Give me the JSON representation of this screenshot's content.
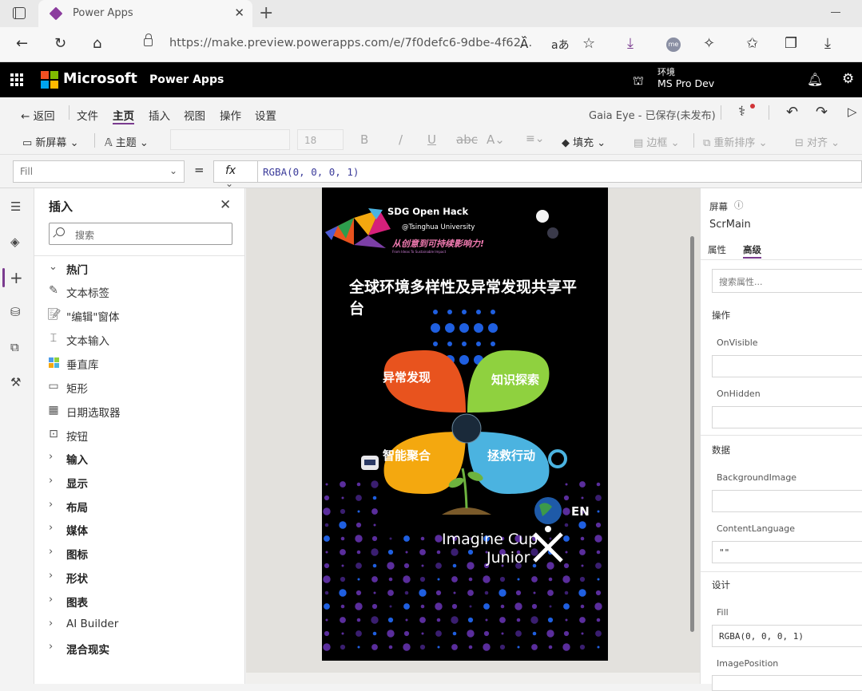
{
  "browser": {
    "tab_title": "Power Apps",
    "url": "https://make.preview.powerapps.com/e/7f0defc6-9dbe-4f62...",
    "profile_initials": "me"
  },
  "appbar": {
    "brand": "Microsoft",
    "product": "Power Apps",
    "env_label": "环境",
    "env_name": "MS Pro Dev"
  },
  "menu": {
    "back": "返回",
    "items": [
      "文件",
      "主页",
      "插入",
      "视图",
      "操作",
      "设置"
    ],
    "active": "主页",
    "saved_status": "Gaia Eye - 已保存(未发布)"
  },
  "toolbar": {
    "new_screen": "新屏幕",
    "theme": "主题",
    "font_size": "18",
    "bold": "B",
    "italic": "/",
    "underline": "U",
    "fill": "填充",
    "border": "边框",
    "reorder": "重新排序",
    "align": "对齐"
  },
  "formula_bar": {
    "property": "Fill",
    "equals": "=",
    "fx": "fx",
    "formula": "RGBA(0, 0, 0, 1)"
  },
  "insert_pane": {
    "title": "插入",
    "search_placeholder": "搜索",
    "popular": "热门",
    "popular_items": [
      "文本标签",
      "\"编辑\"窗体",
      "文本输入",
      "垂直库",
      "矩形",
      "日期选取器",
      "按钮"
    ],
    "groups": [
      "输入",
      "显示",
      "布局",
      "媒体",
      "图标",
      "形状",
      "图表",
      "AI Builder",
      "混合现实"
    ]
  },
  "canvas": {
    "header_title": "SDG Open Hack",
    "header_sub": "@Tsinghua University",
    "slogan": "从创意到可持续影响力!",
    "slogan_en": "From Ideas To Sustainable Impact",
    "title": "全球环境多样性及异常发现共享平台",
    "petal_1": "异常发现",
    "petal_2": "知识探索",
    "petal_3": "智能聚合",
    "petal_4": "拯救行动",
    "lang": "EN",
    "imagine_1": "Imagine Cup",
    "imagine_2": "Junior"
  },
  "properties": {
    "section": "屏幕",
    "screen_name": "ScrMain",
    "tab_props": "属性",
    "tab_advanced": "高级",
    "search_placeholder": "搜索属性...",
    "group_actions": "操作",
    "on_visible": "OnVisible",
    "on_hidden": "OnHidden",
    "group_data": "数据",
    "background_image": "BackgroundImage",
    "content_language": "ContentLanguage",
    "content_language_value": "\"\"",
    "group_design": "设计",
    "fill": "Fill",
    "fill_value": "RGBA(0, 0, 0, 1)",
    "image_position": "ImagePosition"
  },
  "colors": {
    "accent": "#7a3b8f",
    "petal_orange": "#e8531e",
    "petal_green": "#8fd13f",
    "petal_yellow": "#f4a80f",
    "petal_blue": "#4bb3e0",
    "dot_purple": "#5a2d9c",
    "dot_blue": "#1f5fe0"
  }
}
